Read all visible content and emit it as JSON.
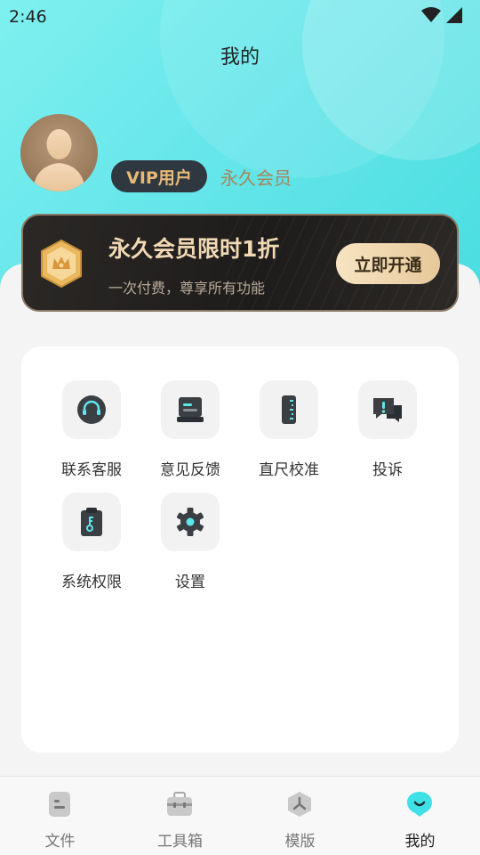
{
  "status": {
    "time": "2:46"
  },
  "header": {
    "title": "我的"
  },
  "profile": {
    "vip_label": "VIP用户",
    "member_type": "永久会员"
  },
  "promo": {
    "title": "永久会员限时1折",
    "subtitle": "一次付费，尊享所有功能",
    "button_label": "立即开通"
  },
  "tools": [
    {
      "label": "联系客服",
      "icon": "headset-icon"
    },
    {
      "label": "意见反馈",
      "icon": "feedback-icon"
    },
    {
      "label": "直尺校准",
      "icon": "ruler-icon"
    },
    {
      "label": "投诉",
      "icon": "complaint-icon"
    },
    {
      "label": "系统权限",
      "icon": "permission-icon"
    },
    {
      "label": "设置",
      "icon": "gear-icon"
    }
  ],
  "tabbar": {
    "items": [
      {
        "label": "文件",
        "icon": "file-icon"
      },
      {
        "label": "工具箱",
        "icon": "toolbox-icon"
      },
      {
        "label": "模版",
        "icon": "template-icon"
      },
      {
        "label": "我的",
        "icon": "profile-icon"
      }
    ],
    "active_index": 3
  },
  "colors": {
    "accent": "#48dde0",
    "gold": "#e6c89a",
    "dark": "#2f3840"
  }
}
